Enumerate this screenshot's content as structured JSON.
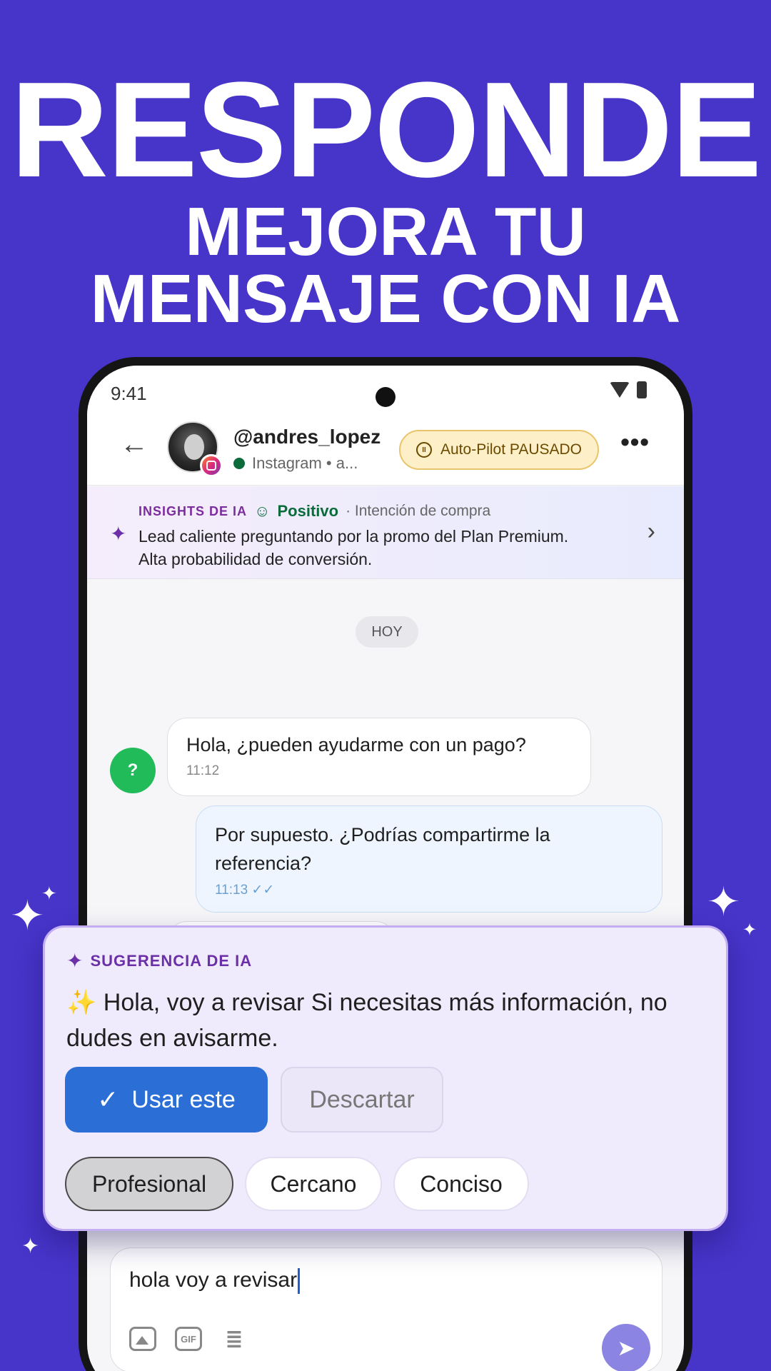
{
  "promo": {
    "headline": "RESPONDE",
    "subheadline_line1": "MEJORA TU",
    "subheadline_line2": "MENSAJE CON IA"
  },
  "status_bar": {
    "time": "9:41"
  },
  "chat_header": {
    "username": "@andres_lopez",
    "channel_status": "Instagram • a...",
    "autopilot_label": "Auto-Pilot PAUSADO"
  },
  "insights": {
    "label": "INSIGHTS DE IA",
    "sentiment": "Positivo",
    "intent": "· Intención de compra",
    "summary": "Lead caliente preguntando por la promo del Plan Premium. Alta probabilidad de conversión."
  },
  "chat": {
    "day_label": "HOY",
    "contact_initial": "?",
    "messages": [
      {
        "direction": "incoming",
        "text": "Hola, ¿pueden ayudarme con un pago?",
        "time": "11:12"
      },
      {
        "direction": "outgoing",
        "text": "Por supuesto. ¿Podrías compartirme la referencia?",
        "time": "11:13"
      }
    ]
  },
  "ai_suggestion": {
    "label": "SUGERENCIA DE IA",
    "emoji": "✨",
    "text": "Hola, voy a revisar Si necesitas más información, no dudes en avisarme.",
    "use_label": "Usar este",
    "discard_label": "Descartar",
    "tones": [
      "Profesional",
      "Cercano",
      "Conciso"
    ],
    "active_tone": "Profesional"
  },
  "composer": {
    "value": "hola voy a revisar",
    "gif_label": "GIF"
  },
  "colors": {
    "background": "#4734c9",
    "primary_button": "#2b6fd6",
    "ai_accent": "#6b2fa8",
    "positive": "#0b6b3a"
  }
}
